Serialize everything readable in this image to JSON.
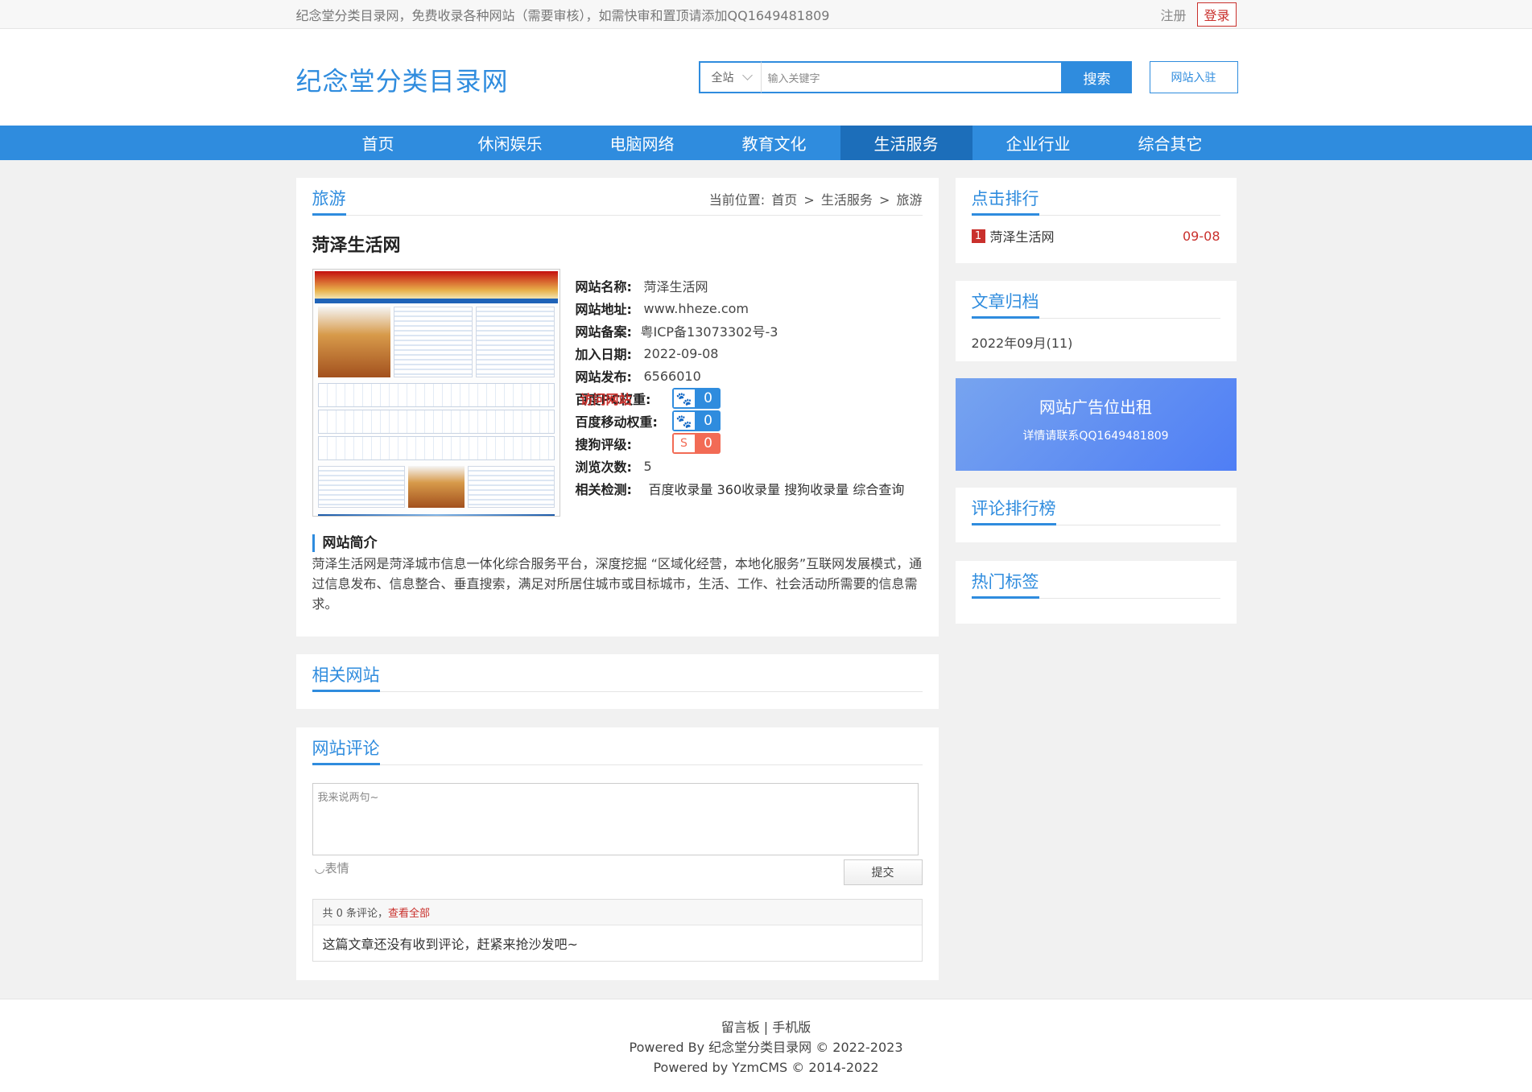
{
  "topbar": {
    "notice": "纪念堂分类目录网，免费收录各种网站（需要审核），如需快审和置顶请添加QQ1649481809",
    "register": "注册",
    "login": "登录"
  },
  "header": {
    "logo": "纪念堂分类目录网",
    "search_scope": "全站",
    "search_placeholder": "输入关键字",
    "search_button": "搜索",
    "submit_site": "网站入驻"
  },
  "nav": {
    "items": [
      "首页",
      "休闲娱乐",
      "电脑网络",
      "教育文化",
      "生活服务",
      "企业行业",
      "综合其它"
    ],
    "active_index": 4
  },
  "detail": {
    "category_title": "旅游",
    "breadcrumb_prefix": "当前位置:",
    "breadcrumb": [
      "首页",
      "生活服务",
      "旅游"
    ],
    "site_title": "菏泽生活网",
    "fields": {
      "name_label": "网站名称:",
      "name": "菏泽生活网",
      "url_label": "网站地址:",
      "url": "www.hheze.com",
      "icp_label": "网站备案:",
      "icp": "粤ICP备13073302号-3",
      "date_label": "加入日期:",
      "date": "2022-09-08",
      "publisher_label": "网站发布:",
      "publisher": "6566010",
      "baidu_pc_label": "百度PC权重:",
      "baidu_pc": "0",
      "baidu_mobile_label": "百度移动权重:",
      "baidu_mobile": "0",
      "sogou_label": "搜狗评级:",
      "sogou": "0",
      "views_label": "浏览次数:",
      "views": "5",
      "checks_label": "相关检测:",
      "checks": [
        "百度收录量",
        "360收录量",
        "搜狗收录量",
        "综合查询"
      ]
    },
    "visit": "访问网站",
    "intro_title": "网站简介",
    "intro": "菏泽生活网是菏泽城市信息一体化综合服务平台，深度挖掘 “区域化经营，本地化服务”互联网发展模式，通过信息发布、信息整合、垂直搜索，满足对所居住城市或目标城市，生活、工作、社会活动所需要的信息需求。"
  },
  "related": {
    "title": "相关网站"
  },
  "comments": {
    "title": "网站评论",
    "placeholder": "我来说两句~",
    "emoji": "表情",
    "submit": "提交",
    "count_text": "共 0 条评论，",
    "view_all": "查看全部",
    "empty": "这篇文章还没有收到评论，赶紧来抢沙发吧~"
  },
  "sidebar": {
    "clicks_title": "点击排行",
    "rank": {
      "no": "1",
      "name": "菏泽生活网",
      "date": "09-08"
    },
    "archive_title": "文章归档",
    "archive_item": "2022年09月(11)",
    "ad_title": "网站广告位出租",
    "ad_sub": "详情请联系QQ1649481809",
    "comment_rank_title": "评论排行榜",
    "tags_title": "热门标签"
  },
  "footer": {
    "guestbook": "留言板",
    "mobile": "手机版",
    "line2": "Powered By 纪念堂分类目录网 © 2022-2023",
    "line3": "Powered by YzmCMS © 2014-2022"
  },
  "colors": {
    "accent": "#2f8cde",
    "nav_active": "#1c6eba",
    "red": "#c9302c",
    "sogou": "#f26b55"
  }
}
